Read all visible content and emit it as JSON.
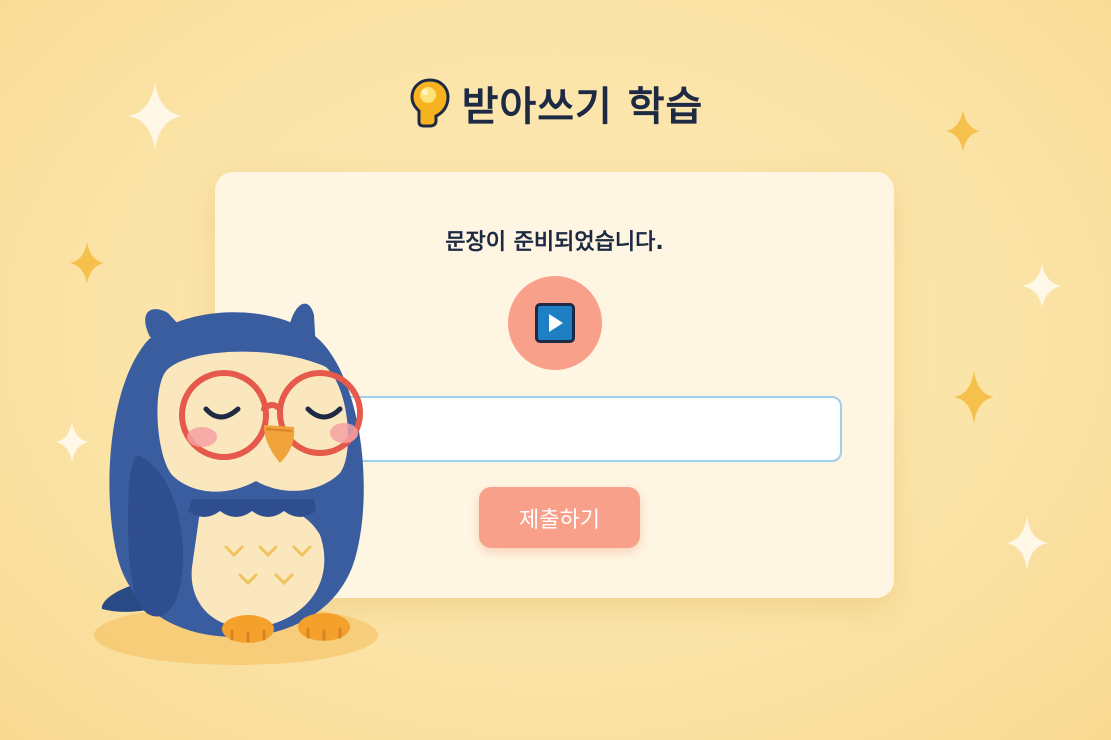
{
  "header": {
    "icon": "lightbulb-icon",
    "title": "받아쓰기 학습"
  },
  "card": {
    "message": "문장이 준비되었습니다.",
    "play_icon": "play-icon",
    "input_value": "",
    "input_placeholder": "",
    "submit_label": "제출하기"
  },
  "mascot": "owl-illustration",
  "colors": {
    "background": "#fbe3a6",
    "card": "#fef6e2",
    "accent": "#f9a08a",
    "title": "#1e2a44",
    "input_border": "#9ccff0"
  }
}
